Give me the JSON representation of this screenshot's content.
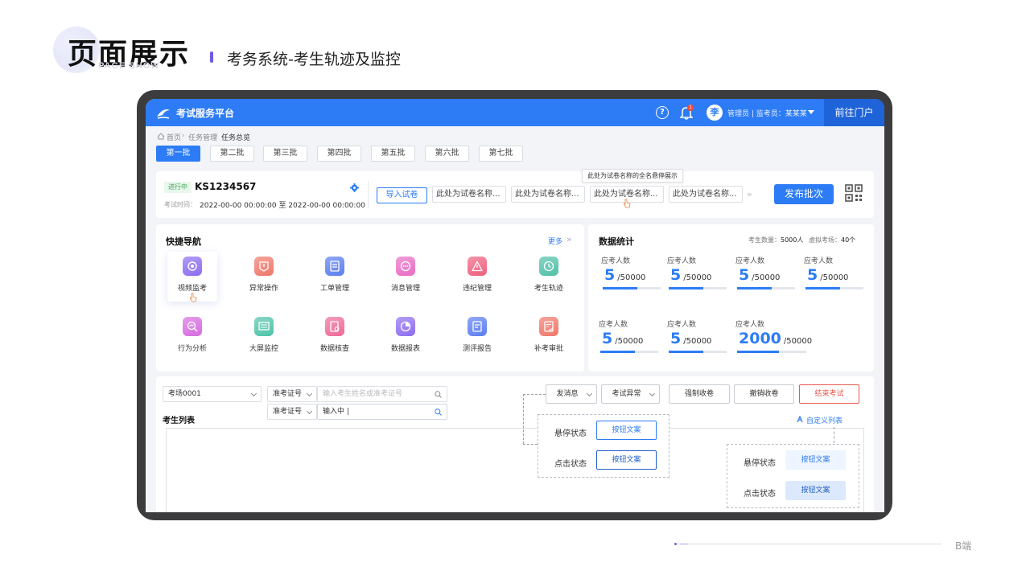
{
  "page": {
    "title": "页面展示",
    "title_en": "PAGE SHOW",
    "subtitle": "考务系统-考生轨迹及监控",
    "footer": "B端"
  },
  "topbar": {
    "app_title": "考试服务平台",
    "bell_badge": "1",
    "avatar": "李",
    "user_text": "管理员 | 监考员：某某某",
    "portal_button": "前往门户",
    "colors": {
      "primary": "#2d7cf6",
      "portal": "#1f63d8"
    }
  },
  "breadcrumb": [
    "首页",
    "任务管理",
    "任务总览"
  ],
  "batch_tabs": [
    "第一批",
    "第二批",
    "第三批",
    "第四批",
    "第五批",
    "第六批",
    "第七批"
  ],
  "exam": {
    "status": "进行中",
    "id": "KS1234567",
    "time_label": "考试时间：",
    "time_value": "2022-00-00 00:00:00 至 2022-00-00 00:00:00",
    "import_button": "导入试卷",
    "papers": [
      "此处为试卷名称...",
      "此处为试卷名称...",
      "此处为试卷名称...",
      "此处为试卷名称..."
    ],
    "tooltip": "此处为试卷名称的全名悬停展示",
    "publish_button": "发布批次"
  },
  "quick_nav": {
    "title": "快捷导航",
    "more": "更多",
    "items": [
      {
        "label": "视频监考",
        "icon": "video-monitor-icon",
        "color": "#8b6cf0"
      },
      {
        "label": "异常操作",
        "icon": "exception-icon",
        "color": "#f0776a"
      },
      {
        "label": "工单管理",
        "icon": "ticket-icon",
        "color": "#5b7df0"
      },
      {
        "label": "消息管理",
        "icon": "message-icon",
        "color": "#e86cc4"
      },
      {
        "label": "违纪管理",
        "icon": "violation-icon",
        "color": "#ef5f7e"
      },
      {
        "label": "考生轨迹",
        "icon": "track-icon",
        "color": "#4fc0a6"
      },
      {
        "label": "行为分析",
        "icon": "behavior-icon",
        "color": "#d66be0"
      },
      {
        "label": "大屏监控",
        "icon": "big-screen-icon",
        "color": "#4fc3a8"
      },
      {
        "label": "数据核查",
        "icon": "data-check-icon",
        "color": "#ef6a95"
      },
      {
        "label": "数据报表",
        "icon": "data-report-icon",
        "color": "#8d6cf0"
      },
      {
        "label": "测评报告",
        "icon": "eval-report-icon",
        "color": "#5b7df0"
      },
      {
        "label": "补考审批",
        "icon": "makeup-approval-icon",
        "color": "#f0776a"
      }
    ]
  },
  "stats": {
    "title": "数据统计",
    "examinee_count_label": "考生数量：",
    "examinee_count": "5000人",
    "virtual_room_label": "虚拟考场：",
    "virtual_room_count": "40个",
    "items": [
      {
        "label": "应考人数",
        "value": "5",
        "total": "/50000",
        "progress": 0.6
      },
      {
        "label": "应考人数",
        "value": "5",
        "total": "/50000",
        "progress": 0.6
      },
      {
        "label": "应考人数",
        "value": "5",
        "total": "/50000",
        "progress": 0.6
      },
      {
        "label": "应考人数",
        "value": "5",
        "total": "/50000",
        "progress": 0.6
      },
      {
        "label": "应考人数",
        "value": "5",
        "total": "/50000",
        "progress": 0.6
      },
      {
        "label": "应考人数",
        "value": "5",
        "total": "/50000",
        "progress": 0.6
      },
      {
        "label": "应考人数",
        "value": "2000",
        "total": "/50000",
        "progress": 0.6
      }
    ]
  },
  "student_list": {
    "room_select": "考场0001",
    "id_type_select": "准考证号",
    "search_placeholder": "输入考生姓名或准考证号",
    "id_type_select_2": "准考证号",
    "search_value": "输入中 |",
    "title": "考生列表",
    "send_msg": "发消息",
    "exam_exception": "考试异常",
    "force_collect": "强制收卷",
    "cancel_collect": "撤销收卷",
    "end_exam": "结束考试",
    "custom_columns": "自定义列表"
  },
  "states": {
    "hover_label": "悬停状态",
    "click_label": "点击状态",
    "button_text": "按钮文案"
  }
}
